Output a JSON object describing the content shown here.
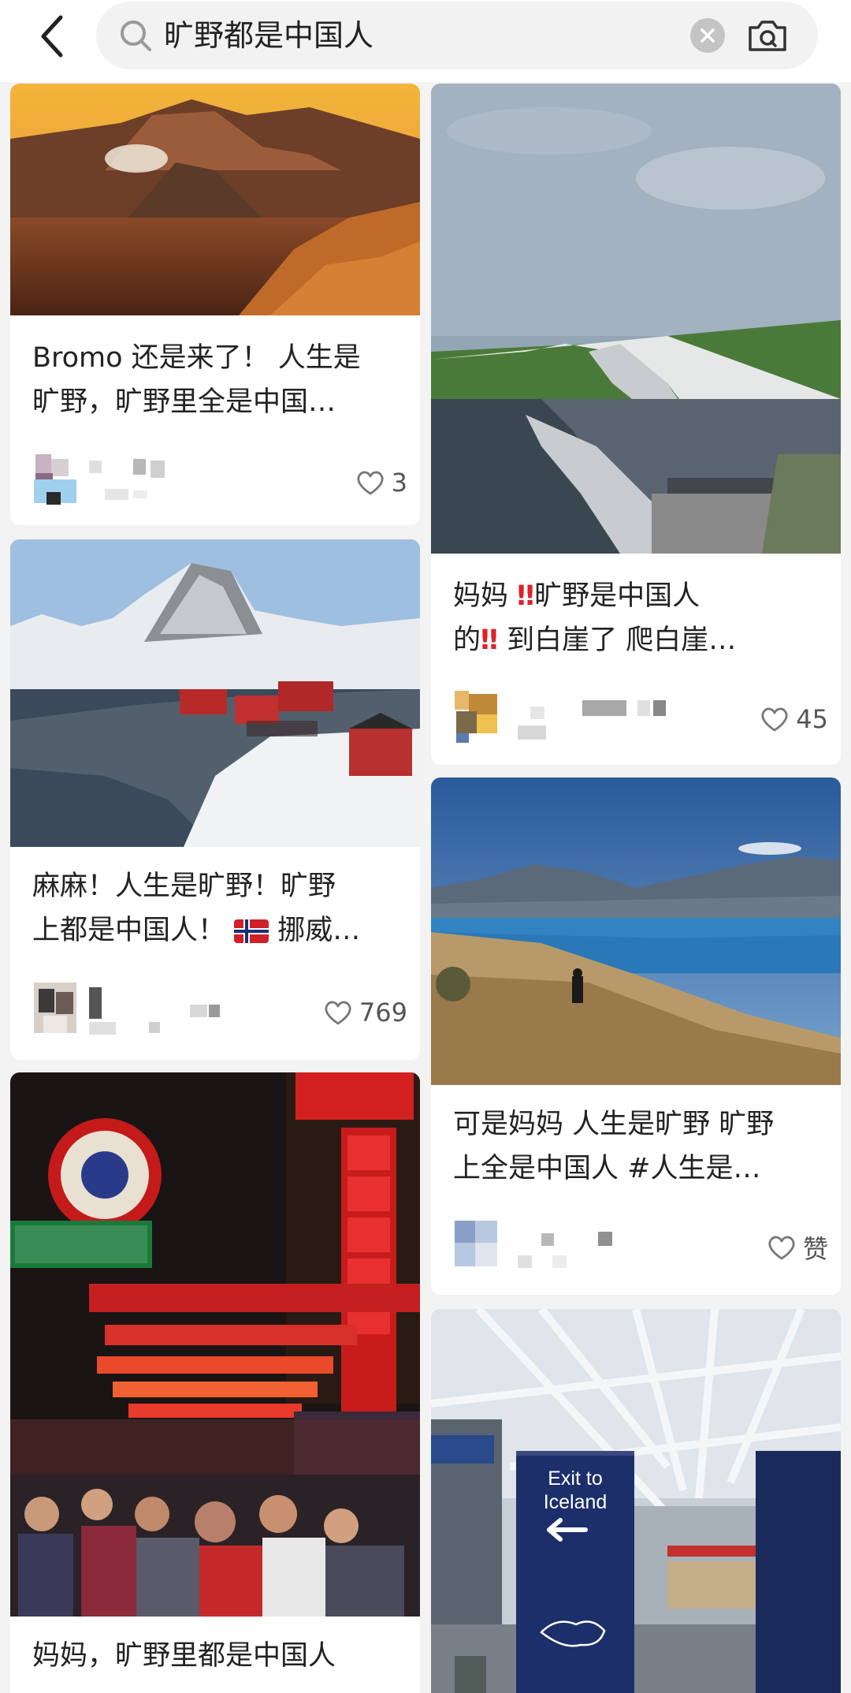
{
  "header": {
    "back_icon": "chevron-left-icon",
    "search_query": "旷野都是中国人",
    "search_icon": "search-icon",
    "clear_icon": "clear-icon",
    "camera_icon": "camera-icon"
  },
  "feed": {
    "left": [
      {
        "image_desc": "volcano-landscape-sunset",
        "title_line1": "Bromo 还是来了！ 人生是",
        "title_line2": "旷野，旷野里全是中国…",
        "likes": "3"
      },
      {
        "image_desc": "snowy-mountain-red-cabins",
        "title_line1": "麻麻！人生是旷野！旷野",
        "title_line2_pre": "上都是中国人！ ",
        "title_line2_post": " 挪威…",
        "flag": "norway-flag-icon",
        "likes": "769"
      },
      {
        "image_desc": "night-market-neon-signs",
        "title_line1": "妈妈，旷野里都是中国人"
      }
    ],
    "right": [
      {
        "image_desc": "white-cliffs-coast",
        "title_line1_pre": "妈妈 ",
        "title_line1_post": "旷野是中国人",
        "title_line2_pre": "的",
        "title_line2_post": " 到白崖了 爬白崖…",
        "bangbang": "‼",
        "likes": "45"
      },
      {
        "image_desc": "lake-mountains-hiker",
        "title_line1": "可是妈妈 人生是旷野 旷野",
        "title_line2": "上全是中国人 #人生是…",
        "likes": "赞"
      },
      {
        "image_desc": "airport-exit-to-iceland-sign",
        "sign_line1": "Exit to",
        "sign_line2": "Iceland"
      }
    ]
  },
  "colors": {
    "background": "#f3f3f3",
    "card": "#ffffff",
    "text": "#222222",
    "muted": "#555555",
    "accent_red": "#e0202a"
  }
}
